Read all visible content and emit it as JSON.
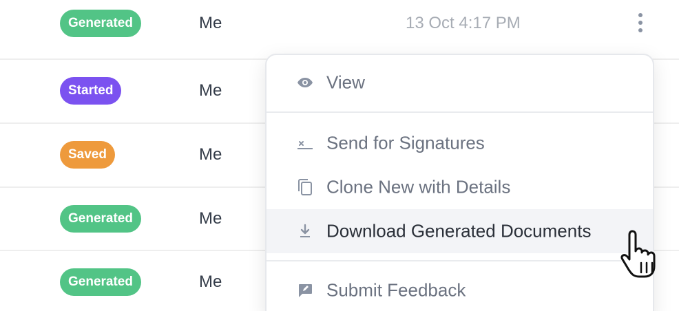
{
  "rows": [
    {
      "status": "Generated",
      "status_color": "#52c486",
      "owner": "Me",
      "date": "13 Oct 4:17 PM"
    },
    {
      "status": "Started",
      "status_color": "#7b52f0",
      "owner": "Me",
      "date": ""
    },
    {
      "status": "Saved",
      "status_color": "#ee9a3c",
      "owner": "Me",
      "date": ""
    },
    {
      "status": "Generated",
      "status_color": "#52c486",
      "owner": "Me",
      "date": ""
    },
    {
      "status": "Generated",
      "status_color": "#52c486",
      "owner": "Me",
      "date": ""
    }
  ],
  "menu": {
    "items": [
      {
        "label": "View",
        "icon": "eye-icon"
      },
      {
        "label": "Send for Signatures",
        "icon": "signature-icon"
      },
      {
        "label": "Clone New with Details",
        "icon": "copy-icon"
      },
      {
        "label": "Download Generated Documents",
        "icon": "download-icon",
        "hovered": true
      },
      {
        "label": "Submit Feedback",
        "icon": "feedback-icon"
      }
    ]
  },
  "colors": {
    "generated": "#52c486",
    "started": "#7b52f0",
    "saved": "#ee9a3c",
    "icon": "#8a93a3"
  }
}
